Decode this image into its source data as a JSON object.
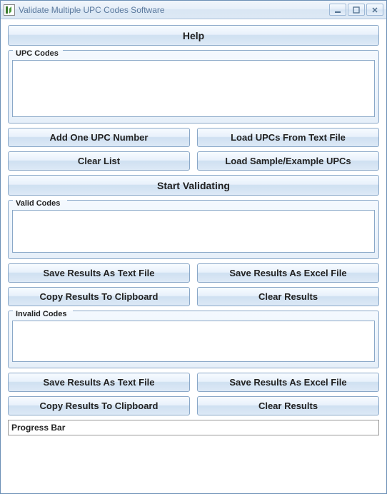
{
  "window": {
    "title": "Validate Multiple UPC Codes Software"
  },
  "help_button": "Help",
  "upc": {
    "legend": "UPC Codes",
    "content": "",
    "add_one": "Add One UPC Number",
    "load_file": "Load UPCs From Text File",
    "clear": "Clear List",
    "load_sample": "Load Sample/Example UPCs"
  },
  "start_button": "Start Validating",
  "valid": {
    "legend": "Valid Codes",
    "content": "",
    "save_text": "Save Results As Text File",
    "save_excel": "Save Results As Excel File",
    "copy": "Copy Results To Clipboard",
    "clear": "Clear Results"
  },
  "invalid": {
    "legend": "Invalid Codes",
    "content": "",
    "save_text": "Save Results As Text File",
    "save_excel": "Save Results As Excel File",
    "copy": "Copy Results To Clipboard",
    "clear": "Clear Results"
  },
  "progress": {
    "label": "Progress Bar"
  }
}
